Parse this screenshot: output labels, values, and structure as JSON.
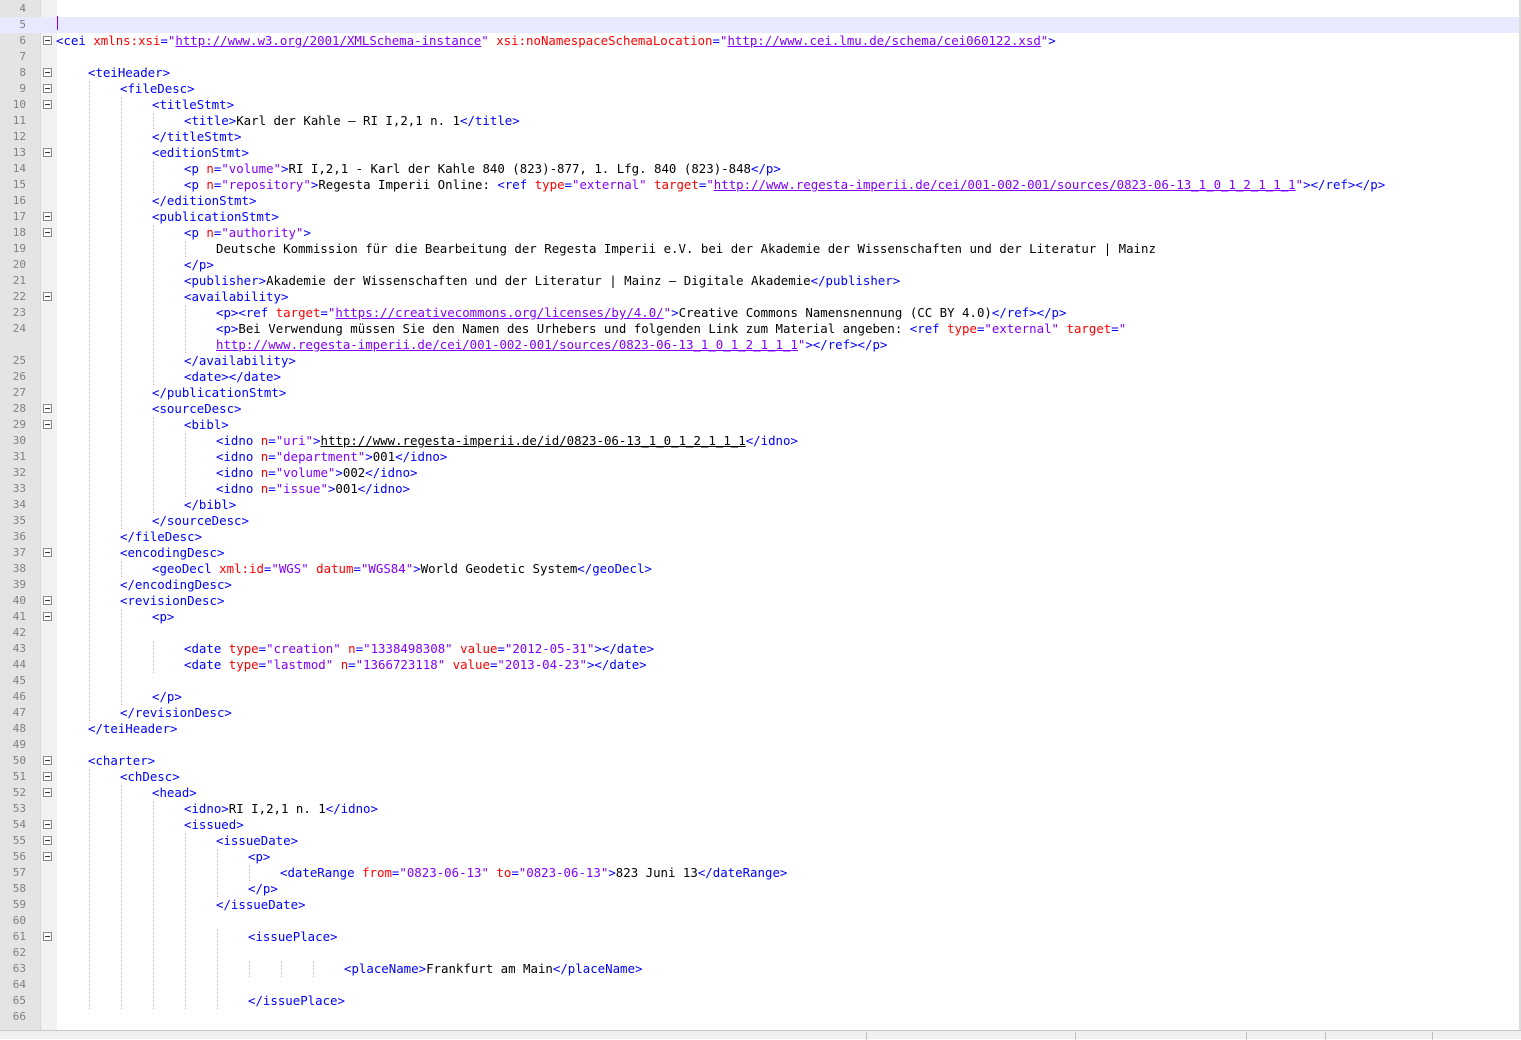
{
  "editor": {
    "lines": [
      {
        "n": "4",
        "i": 0,
        "f": false,
        "s": []
      },
      {
        "n": "5",
        "i": 0,
        "f": false,
        "s": [],
        "current": true
      },
      {
        "n": "6",
        "i": 0,
        "f": true,
        "s": [
          [
            "t",
            "<cei"
          ],
          [
            "x",
            " "
          ],
          [
            "a",
            "xmlns:xsi"
          ],
          [
            "t",
            "="
          ],
          [
            "v",
            "\""
          ],
          [
            "vu",
            "http://www.w3.org/2001/XMLSchema-instance"
          ],
          [
            "v",
            "\""
          ],
          [
            "x",
            " "
          ],
          [
            "a",
            "xsi:noNamespaceSchemaLocation"
          ],
          [
            "t",
            "="
          ],
          [
            "v",
            "\""
          ],
          [
            "vu",
            "http://www.cei.lmu.de/schema/cei060122.xsd"
          ],
          [
            "v",
            "\""
          ],
          [
            "t",
            ">"
          ]
        ]
      },
      {
        "n": "7",
        "i": 0,
        "f": false,
        "s": []
      },
      {
        "n": "8",
        "i": 1,
        "f": true,
        "s": [
          [
            "t",
            "<teiHeader>"
          ]
        ]
      },
      {
        "n": "9",
        "i": 2,
        "f": true,
        "s": [
          [
            "t",
            "<fileDesc>"
          ]
        ]
      },
      {
        "n": "10",
        "i": 3,
        "f": true,
        "s": [
          [
            "t",
            "<titleStmt>"
          ]
        ]
      },
      {
        "n": "11",
        "i": 4,
        "f": false,
        "s": [
          [
            "t",
            "<title>"
          ],
          [
            "x",
            "Karl der Kahle – RI I,2,1 n. 1"
          ],
          [
            "t",
            "</title>"
          ]
        ]
      },
      {
        "n": "12",
        "i": 3,
        "f": false,
        "s": [
          [
            "t",
            "</titleStmt>"
          ]
        ]
      },
      {
        "n": "13",
        "i": 3,
        "f": true,
        "s": [
          [
            "t",
            "<editionStmt>"
          ]
        ]
      },
      {
        "n": "14",
        "i": 4,
        "f": false,
        "s": [
          [
            "t",
            "<p"
          ],
          [
            "x",
            " "
          ],
          [
            "a",
            "n"
          ],
          [
            "t",
            "="
          ],
          [
            "v",
            "\"volume\""
          ],
          [
            "t",
            ">"
          ],
          [
            "x",
            "RI I,2,1 - Karl der Kahle 840 (823)-877, 1. Lfg. 840 (823)-848"
          ],
          [
            "t",
            "</p>"
          ]
        ]
      },
      {
        "n": "15",
        "i": 4,
        "f": false,
        "s": [
          [
            "t",
            "<p"
          ],
          [
            "x",
            " "
          ],
          [
            "a",
            "n"
          ],
          [
            "t",
            "="
          ],
          [
            "v",
            "\"repository\""
          ],
          [
            "t",
            ">"
          ],
          [
            "x",
            "Regesta Imperii Online: "
          ],
          [
            "t",
            "<ref"
          ],
          [
            "x",
            " "
          ],
          [
            "a",
            "type"
          ],
          [
            "t",
            "="
          ],
          [
            "v",
            "\"external\""
          ],
          [
            "x",
            " "
          ],
          [
            "a",
            "target"
          ],
          [
            "t",
            "="
          ],
          [
            "v",
            "\""
          ],
          [
            "vu",
            "http://www.regesta-imperii.de/cei/001-002-001/sources/0823-06-13_1_0_1_2_1_1_1"
          ],
          [
            "v",
            "\""
          ],
          [
            "t",
            "></ref></p>"
          ]
        ]
      },
      {
        "n": "16",
        "i": 3,
        "f": false,
        "s": [
          [
            "t",
            "</editionStmt>"
          ]
        ]
      },
      {
        "n": "17",
        "i": 3,
        "f": true,
        "s": [
          [
            "t",
            "<publicationStmt>"
          ]
        ]
      },
      {
        "n": "18",
        "i": 4,
        "f": true,
        "s": [
          [
            "t",
            "<p"
          ],
          [
            "x",
            " "
          ],
          [
            "a",
            "n"
          ],
          [
            "t",
            "="
          ],
          [
            "v",
            "\"authority\""
          ],
          [
            "t",
            ">"
          ]
        ]
      },
      {
        "n": "19",
        "i": 5,
        "f": false,
        "s": [
          [
            "x",
            "Deutsche Kommission für die Bearbeitung der Regesta Imperii e.V. bei der Akademie der Wissenschaften und der Literatur | Mainz"
          ]
        ]
      },
      {
        "n": "20",
        "i": 4,
        "f": false,
        "s": [
          [
            "t",
            "</p>"
          ]
        ]
      },
      {
        "n": "21",
        "i": 4,
        "f": false,
        "s": [
          [
            "t",
            "<publisher>"
          ],
          [
            "x",
            "Akademie der Wissenschaften und der Literatur | Mainz – Digitale Akademie"
          ],
          [
            "t",
            "</publisher>"
          ]
        ]
      },
      {
        "n": "22",
        "i": 4,
        "f": true,
        "s": [
          [
            "t",
            "<availability>"
          ]
        ]
      },
      {
        "n": "23",
        "i": 5,
        "f": false,
        "s": [
          [
            "t",
            "<p><ref"
          ],
          [
            "x",
            " "
          ],
          [
            "a",
            "target"
          ],
          [
            "t",
            "="
          ],
          [
            "v",
            "\""
          ],
          [
            "vu",
            "https://creativecommons.org/licenses/by/4.0/"
          ],
          [
            "v",
            "\""
          ],
          [
            "t",
            ">"
          ],
          [
            "x",
            "Creative Commons Namensnennung (CC BY 4.0)"
          ],
          [
            "t",
            "</ref></p>"
          ]
        ]
      },
      {
        "n": "24",
        "i": 5,
        "f": false,
        "s": [
          [
            "t",
            "<p>"
          ],
          [
            "x",
            "Bei Verwendung müssen Sie den Namen des Urhebers und folgenden Link zum Material angeben: "
          ],
          [
            "t",
            "<ref"
          ],
          [
            "x",
            " "
          ],
          [
            "a",
            "type"
          ],
          [
            "t",
            "="
          ],
          [
            "v",
            "\"external\""
          ],
          [
            "x",
            " "
          ],
          [
            "a",
            "target"
          ],
          [
            "t",
            "="
          ],
          [
            "v",
            "\""
          ]
        ]
      },
      {
        "n": "",
        "i": 5,
        "f": false,
        "s": [
          [
            "vu",
            "http://www.regesta-imperii.de/cei/001-002-001/sources/0823-06-13_1_0_1_2_1_1_1"
          ],
          [
            "v",
            "\""
          ],
          [
            "t",
            "></ref></p>"
          ]
        ]
      },
      {
        "n": "25",
        "i": 4,
        "f": false,
        "s": [
          [
            "t",
            "</availability>"
          ]
        ]
      },
      {
        "n": "26",
        "i": 4,
        "f": false,
        "s": [
          [
            "t",
            "<date></date>"
          ]
        ]
      },
      {
        "n": "27",
        "i": 3,
        "f": false,
        "s": [
          [
            "t",
            "</publicationStmt>"
          ]
        ]
      },
      {
        "n": "28",
        "i": 3,
        "f": true,
        "s": [
          [
            "t",
            "<sourceDesc>"
          ]
        ]
      },
      {
        "n": "29",
        "i": 4,
        "f": true,
        "s": [
          [
            "t",
            "<bibl>"
          ]
        ]
      },
      {
        "n": "30",
        "i": 5,
        "f": false,
        "s": [
          [
            "t",
            "<idno"
          ],
          [
            "x",
            " "
          ],
          [
            "a",
            "n"
          ],
          [
            "t",
            "="
          ],
          [
            "v",
            "\"uri\""
          ],
          [
            "t",
            ">"
          ],
          [
            "xu",
            "http://www.regesta-imperii.de/id/0823-06-13_1_0_1_2_1_1_1"
          ],
          [
            "t",
            "</idno>"
          ]
        ]
      },
      {
        "n": "31",
        "i": 5,
        "f": false,
        "s": [
          [
            "t",
            "<idno"
          ],
          [
            "x",
            " "
          ],
          [
            "a",
            "n"
          ],
          [
            "t",
            "="
          ],
          [
            "v",
            "\"department\""
          ],
          [
            "t",
            ">"
          ],
          [
            "x",
            "001"
          ],
          [
            "t",
            "</idno>"
          ]
        ]
      },
      {
        "n": "32",
        "i": 5,
        "f": false,
        "s": [
          [
            "t",
            "<idno"
          ],
          [
            "x",
            " "
          ],
          [
            "a",
            "n"
          ],
          [
            "t",
            "="
          ],
          [
            "v",
            "\"volume\""
          ],
          [
            "t",
            ">"
          ],
          [
            "x",
            "002"
          ],
          [
            "t",
            "</idno>"
          ]
        ]
      },
      {
        "n": "33",
        "i": 5,
        "f": false,
        "s": [
          [
            "t",
            "<idno"
          ],
          [
            "x",
            " "
          ],
          [
            "a",
            "n"
          ],
          [
            "t",
            "="
          ],
          [
            "v",
            "\"issue\""
          ],
          [
            "t",
            ">"
          ],
          [
            "x",
            "001"
          ],
          [
            "t",
            "</idno>"
          ]
        ]
      },
      {
        "n": "34",
        "i": 4,
        "f": false,
        "s": [
          [
            "t",
            "</bibl>"
          ]
        ]
      },
      {
        "n": "35",
        "i": 3,
        "f": false,
        "s": [
          [
            "t",
            "</sourceDesc>"
          ]
        ]
      },
      {
        "n": "36",
        "i": 2,
        "f": false,
        "s": [
          [
            "t",
            "</fileDesc>"
          ]
        ]
      },
      {
        "n": "37",
        "i": 2,
        "f": true,
        "s": [
          [
            "t",
            "<encodingDesc>"
          ]
        ]
      },
      {
        "n": "38",
        "i": 3,
        "f": false,
        "s": [
          [
            "t",
            "<geoDecl"
          ],
          [
            "x",
            " "
          ],
          [
            "a",
            "xml:id"
          ],
          [
            "t",
            "="
          ],
          [
            "v",
            "\"WGS\""
          ],
          [
            "x",
            " "
          ],
          [
            "a",
            "datum"
          ],
          [
            "t",
            "="
          ],
          [
            "v",
            "\"WGS84\""
          ],
          [
            "t",
            ">"
          ],
          [
            "x",
            "World Geodetic System"
          ],
          [
            "t",
            "</geoDecl>"
          ]
        ]
      },
      {
        "n": "39",
        "i": 2,
        "f": false,
        "s": [
          [
            "t",
            "</encodingDesc>"
          ]
        ]
      },
      {
        "n": "40",
        "i": 2,
        "f": true,
        "s": [
          [
            "t",
            "<revisionDesc>"
          ]
        ]
      },
      {
        "n": "41",
        "i": 3,
        "f": true,
        "s": [
          [
            "t",
            "<p>"
          ]
        ]
      },
      {
        "n": "42",
        "i": 0,
        "f": false,
        "s": []
      },
      {
        "n": "43",
        "i": 4,
        "f": false,
        "s": [
          [
            "t",
            "<date"
          ],
          [
            "x",
            " "
          ],
          [
            "a",
            "type"
          ],
          [
            "t",
            "="
          ],
          [
            "v",
            "\"creation\""
          ],
          [
            "x",
            " "
          ],
          [
            "a",
            "n"
          ],
          [
            "t",
            "="
          ],
          [
            "v",
            "\"1338498308\""
          ],
          [
            "x",
            " "
          ],
          [
            "a",
            "value"
          ],
          [
            "t",
            "="
          ],
          [
            "v",
            "\"2012-05-31\""
          ],
          [
            "t",
            "></date>"
          ]
        ]
      },
      {
        "n": "44",
        "i": 4,
        "f": false,
        "s": [
          [
            "t",
            "<date"
          ],
          [
            "x",
            " "
          ],
          [
            "a",
            "type"
          ],
          [
            "t",
            "="
          ],
          [
            "v",
            "\"lastmod\""
          ],
          [
            "x",
            " "
          ],
          [
            "a",
            "n"
          ],
          [
            "t",
            "="
          ],
          [
            "v",
            "\"1366723118\""
          ],
          [
            "x",
            " "
          ],
          [
            "a",
            "value"
          ],
          [
            "t",
            "="
          ],
          [
            "v",
            "\"2013-04-23\""
          ],
          [
            "t",
            "></date>"
          ]
        ]
      },
      {
        "n": "45",
        "i": 0,
        "f": false,
        "s": []
      },
      {
        "n": "46",
        "i": 3,
        "f": false,
        "s": [
          [
            "t",
            "</p>"
          ]
        ]
      },
      {
        "n": "47",
        "i": 2,
        "f": false,
        "s": [
          [
            "t",
            "</revisionDesc>"
          ]
        ]
      },
      {
        "n": "48",
        "i": 1,
        "f": false,
        "s": [
          [
            "t",
            "</teiHeader>"
          ]
        ]
      },
      {
        "n": "49",
        "i": 0,
        "f": false,
        "s": []
      },
      {
        "n": "50",
        "i": 1,
        "f": true,
        "s": [
          [
            "t",
            "<charter>"
          ]
        ]
      },
      {
        "n": "51",
        "i": 2,
        "f": true,
        "s": [
          [
            "t",
            "<chDesc>"
          ]
        ]
      },
      {
        "n": "52",
        "i": 3,
        "f": true,
        "s": [
          [
            "t",
            "<head>"
          ]
        ]
      },
      {
        "n": "53",
        "i": 4,
        "f": false,
        "s": [
          [
            "t",
            "<idno>"
          ],
          [
            "x",
            "RI I,2,1 n. 1"
          ],
          [
            "t",
            "</idno>"
          ]
        ]
      },
      {
        "n": "54",
        "i": 4,
        "f": true,
        "s": [
          [
            "t",
            "<issued>"
          ]
        ]
      },
      {
        "n": "55",
        "i": 5,
        "f": true,
        "s": [
          [
            "t",
            "<issueDate>"
          ]
        ]
      },
      {
        "n": "56",
        "i": 6,
        "f": true,
        "s": [
          [
            "t",
            "<p>"
          ]
        ]
      },
      {
        "n": "57",
        "i": 7,
        "f": false,
        "s": [
          [
            "t",
            "<dateRange"
          ],
          [
            "x",
            " "
          ],
          [
            "a",
            "from"
          ],
          [
            "t",
            "="
          ],
          [
            "v",
            "\"0823-06-13\""
          ],
          [
            "x",
            " "
          ],
          [
            "a",
            "to"
          ],
          [
            "t",
            "="
          ],
          [
            "v",
            "\"0823-06-13\""
          ],
          [
            "t",
            ">"
          ],
          [
            "x",
            "823 Juni 13"
          ],
          [
            "t",
            "</dateRange>"
          ]
        ]
      },
      {
        "n": "58",
        "i": 6,
        "f": false,
        "s": [
          [
            "t",
            "</p>"
          ]
        ]
      },
      {
        "n": "59",
        "i": 5,
        "f": false,
        "s": [
          [
            "t",
            "</issueDate>"
          ]
        ]
      },
      {
        "n": "60",
        "i": 0,
        "f": false,
        "s": []
      },
      {
        "n": "61",
        "i": 6,
        "f": true,
        "s": [
          [
            "t",
            "<issuePlace>"
          ]
        ]
      },
      {
        "n": "62",
        "i": 0,
        "f": false,
        "s": []
      },
      {
        "n": "63",
        "i": 9,
        "f": false,
        "s": [
          [
            "t",
            "<placeName>"
          ],
          [
            "x",
            "Frankfurt am Main"
          ],
          [
            "t",
            "</placeName>"
          ]
        ]
      },
      {
        "n": "64",
        "i": 0,
        "f": false,
        "s": []
      },
      {
        "n": "65",
        "i": 6,
        "f": false,
        "s": [
          [
            "t",
            "</issuePlace>"
          ]
        ]
      },
      {
        "n": "66",
        "i": 0,
        "f": false,
        "s": []
      }
    ]
  }
}
